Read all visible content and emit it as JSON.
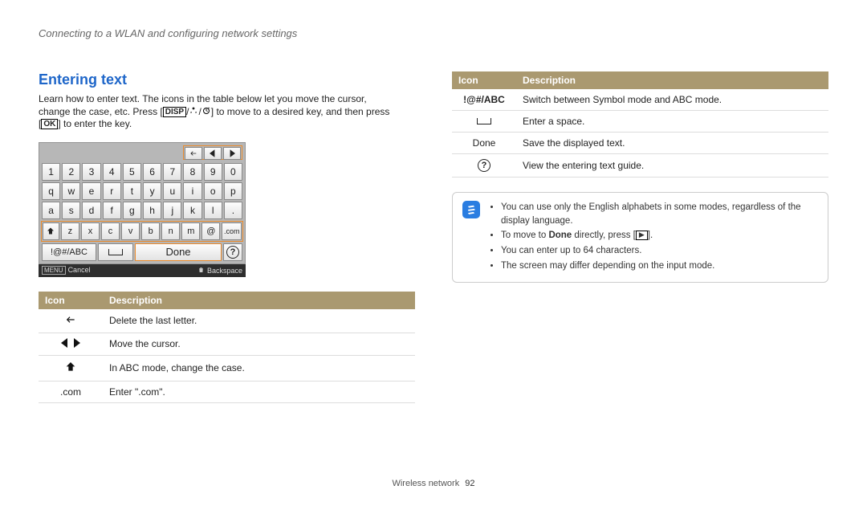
{
  "breadcrumb": "Connecting to a WLAN and configuring network settings",
  "section_title": "Entering text",
  "intro": {
    "line1": "Learn how to enter text. The icons in the table below let you move the cursor,",
    "line2a": "change the case, etc. Press [",
    "disp": "DISP",
    "line2b": "] to move to a desired key, and then press",
    "line3a": "[",
    "ok": "OK",
    "line3b": "] to enter the key."
  },
  "keyboard": {
    "rows": {
      "nums": [
        "1",
        "2",
        "3",
        "4",
        "5",
        "6",
        "7",
        "8",
        "9",
        "0"
      ],
      "r1": [
        "q",
        "w",
        "e",
        "r",
        "t",
        "y",
        "u",
        "i",
        "o",
        "p"
      ],
      "r2": [
        "a",
        "s",
        "d",
        "f",
        "g",
        "h",
        "j",
        "k",
        "l",
        "."
      ],
      "r3": [
        "z",
        "x",
        "c",
        "v",
        "b",
        "n",
        "m",
        "@"
      ],
      "com": ".com"
    },
    "abc_key": "!@#/ABC",
    "done_key": "Done",
    "footer": {
      "cancel_tag": "MENU",
      "cancel": "Cancel",
      "backspace": "Backspace"
    }
  },
  "table_headers": {
    "icon": "Icon",
    "desc": "Description"
  },
  "left_table": [
    {
      "key": "backspace-arrow",
      "desc": "Delete the last letter."
    },
    {
      "key": "move-cursor",
      "desc": "Move the cursor."
    },
    {
      "key": "shift-up",
      "desc": "In ABC mode, change the case."
    },
    {
      "key": "dot-com",
      "label": ".com",
      "desc": "Enter \".com\"."
    }
  ],
  "right_table": [
    {
      "key": "abc-toggle",
      "label": "!@#/ABC",
      "desc": "Switch between Symbol mode and ABC mode."
    },
    {
      "key": "space-bar",
      "desc": "Enter a space."
    },
    {
      "key": "done-key",
      "label": "Done",
      "desc": "Save the displayed text."
    },
    {
      "key": "help-key",
      "desc": "View the entering text guide."
    }
  ],
  "notes": {
    "n1": "You can use only the English alphabets in some modes, regardless of the display language.",
    "n2a": "To move to ",
    "n2b": "Done",
    "n2c": " directly, press [",
    "n2d": "].",
    "n3": "You can enter up to 64 characters.",
    "n4": "The screen may differ depending on the input mode."
  },
  "footer": {
    "section": "Wireless network",
    "page": "92"
  }
}
